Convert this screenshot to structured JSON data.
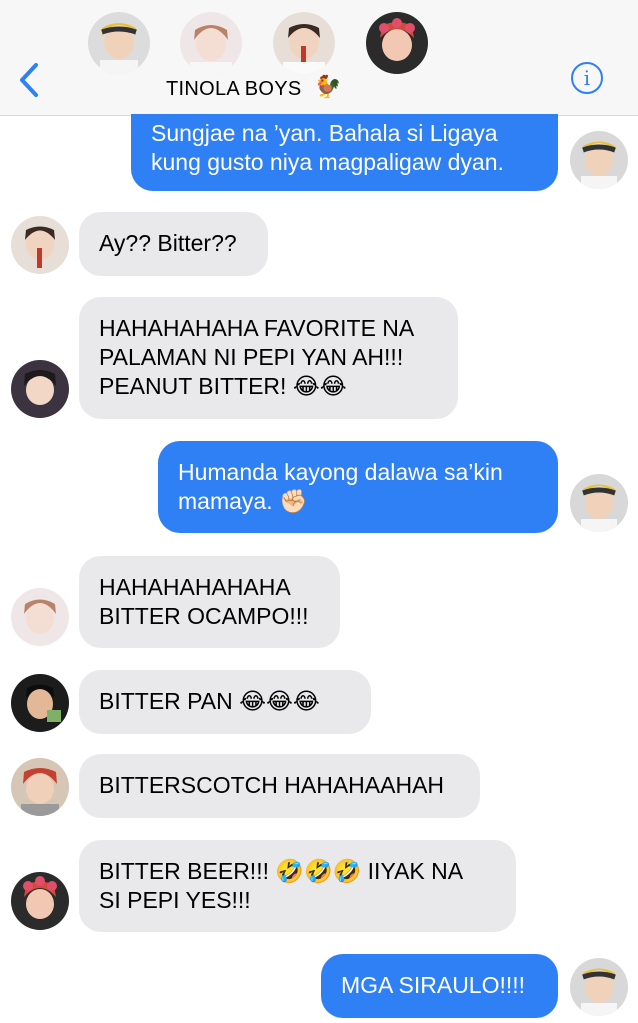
{
  "header": {
    "title": "TINOLA BOYS",
    "title_emoji": "🐓",
    "back_icon": "chevron-left-icon",
    "info_icon": "info-icon",
    "info_glyph": "i",
    "accent": "#2f7ff5"
  },
  "messages": [
    {
      "direction": "outgoing",
      "lines": [
        "Sungjae na ’yan. Bahala si Ligaya",
        "kung gusto niya magpaligaw dyan."
      ]
    },
    {
      "direction": "incoming",
      "lines": [
        "Ay?? Bitter??"
      ]
    },
    {
      "direction": "incoming",
      "lines": [
        "HAHAHAHAHA FAVORITE NA",
        "PALAMAN NI PEPI YAN AH!!!",
        "PEANUT BITTER! 😂😂"
      ]
    },
    {
      "direction": "outgoing",
      "lines": [
        "Humanda kayong dalawa sa’kin",
        "mamaya. ✊🏻"
      ]
    },
    {
      "direction": "incoming",
      "lines": [
        "HAHAHAHAHAHA",
        "BITTER OCAMPO!!!"
      ]
    },
    {
      "direction": "incoming",
      "lines": [
        "BITTER PAN 😂😂😂"
      ]
    },
    {
      "direction": "incoming",
      "lines": [
        "BITTERSCOTCH HAHAHAAHAH"
      ]
    },
    {
      "direction": "incoming",
      "lines": [
        "BITTER BEER!!! 🤣🤣🤣 IIYAK NA",
        "SI PEPI YES!!!"
      ]
    },
    {
      "direction": "outgoing",
      "lines": [
        "MGA SIRAULO!!!!"
      ]
    }
  ],
  "colors": {
    "outgoing_bubble": "#2f7ff5",
    "incoming_bubble": "#e9e9eb",
    "header_bg": "#f7f7f7"
  }
}
